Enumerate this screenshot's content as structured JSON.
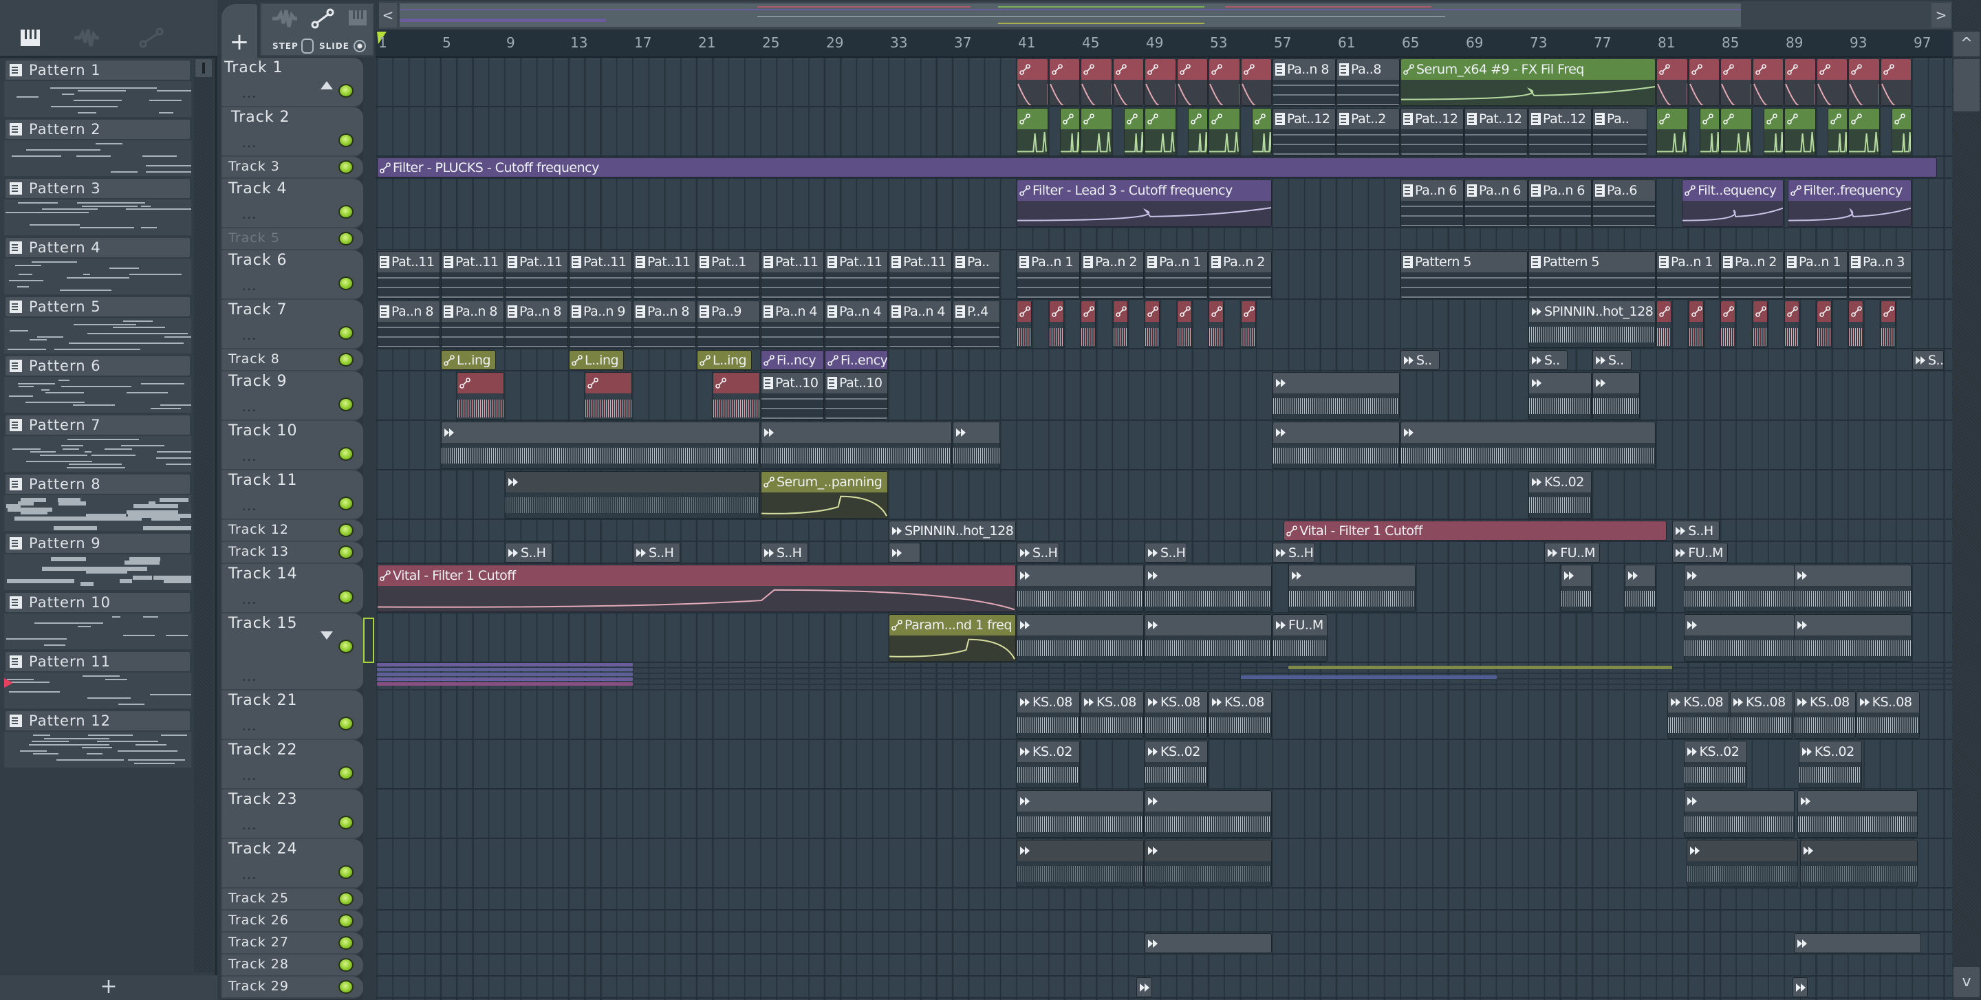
{
  "toolbar": {
    "add_track": "+",
    "step_label": "STEP",
    "slide_label": "SLIDE",
    "add_pattern": "+",
    "scroll_left": "<",
    "scroll_right": ">",
    "scroll_up": "^",
    "scroll_down": "v"
  },
  "patterns": [
    "Pattern 1",
    "Pattern 2",
    "Pattern 3",
    "Pattern 4",
    "Pattern 5",
    "Pattern 6",
    "Pattern 7",
    "Pattern 8",
    "Pattern 9",
    "Pattern 10",
    "Pattern 11",
    "Pattern 12"
  ],
  "playing_pattern": "Pattern 11",
  "ruler": [
    1,
    5,
    9,
    13,
    17,
    21,
    25,
    29,
    33,
    37,
    41,
    45,
    49,
    53,
    57,
    61,
    65,
    69,
    73,
    77,
    81,
    85,
    89,
    93,
    97
  ],
  "tracks": [
    {
      "name": "Track 1"
    },
    {
      "name": "Track 2"
    },
    {
      "name": "Track 3"
    },
    {
      "name": "Track 4"
    },
    {
      "name": "Track 5",
      "disabled": true
    },
    {
      "name": "Track 6"
    },
    {
      "name": "Track 7"
    },
    {
      "name": "Track 8"
    },
    {
      "name": "Track 9"
    },
    {
      "name": "Track 10"
    },
    {
      "name": "Track 11"
    },
    {
      "name": "Track 12"
    },
    {
      "name": "Track 13"
    },
    {
      "name": "Track 14"
    },
    {
      "name": "Track 15"
    },
    {
      "name": "Track 21"
    },
    {
      "name": "Track 22"
    },
    {
      "name": "Track 23"
    },
    {
      "name": "Track 24"
    },
    {
      "name": "Track 25"
    },
    {
      "name": "Track 26"
    },
    {
      "name": "Track 27"
    },
    {
      "name": "Track 28"
    },
    {
      "name": "Track 29"
    }
  ],
  "track_more_label": "...",
  "collapsed_group_lines": [
    {
      "start": 1,
      "len": 16,
      "color": "#6b5c9c"
    },
    {
      "start": 1,
      "len": 16,
      "color": "#5e5f96"
    },
    {
      "start": 1,
      "len": 16,
      "color": "#5e5f96"
    },
    {
      "start": 1,
      "len": 16,
      "color": "#6b5c9c"
    },
    {
      "start": 1,
      "len": 16,
      "color": "#8a4f82"
    },
    {
      "start": 58,
      "len": 24,
      "color": "#7f8a45"
    },
    {
      "start": 55,
      "len": 16,
      "color": "#4f5f96"
    }
  ],
  "clip_colors": {
    "p": {
      "head": "#4b545d",
      "body": "#2c3741"
    },
    "a": {
      "head": "#4d565f",
      "body": "#2e3b45"
    },
    "am": {
      "head": "#41494f",
      "body": "#2e3a44"
    },
    "ar": {
      "head": "#9a4b58",
      "body": "#3b3f48"
    },
    "arw": {
      "head": "#8c4650",
      "body": "#33404a"
    },
    "ag": {
      "head": "#5d8b46",
      "body": "#34453a"
    },
    "au": {
      "head": "#5e5087",
      "body": "#3b3a4f"
    },
    "ao": {
      "head": "#7a8341",
      "body": "#373d33"
    },
    "ap": {
      "head": "#8b4a5e",
      "body": "#3e3c46"
    }
  },
  "clips": [
    [
      1,
      41,
      2,
      "",
      "ar"
    ],
    [
      1,
      43,
      2,
      "",
      "ar"
    ],
    [
      1,
      45,
      2,
      "",
      "ar"
    ],
    [
      1,
      47,
      2,
      "",
      "ar"
    ],
    [
      1,
      49,
      2,
      "",
      "ar"
    ],
    [
      1,
      51,
      2,
      "",
      "ar"
    ],
    [
      1,
      53,
      2,
      "",
      "ar"
    ],
    [
      1,
      55,
      2,
      "",
      "ar"
    ],
    [
      1,
      57,
      4,
      "Pa..n 8",
      "p"
    ],
    [
      1,
      61,
      4,
      "Pa..8",
      "p"
    ],
    [
      1,
      65,
      16,
      "Serum_x64 #9 - FX Fil Freq",
      "ag"
    ],
    [
      1,
      81,
      2,
      "",
      "ar"
    ],
    [
      1,
      83,
      2,
      "",
      "ar"
    ],
    [
      1,
      85,
      2,
      "",
      "ar"
    ],
    [
      1,
      87,
      2,
      "",
      "ar"
    ],
    [
      1,
      89,
      2,
      "",
      "ar"
    ],
    [
      1,
      91,
      2,
      "",
      "ar"
    ],
    [
      1,
      93,
      2,
      "",
      "ar"
    ],
    [
      1,
      95,
      2,
      "",
      "ar"
    ],
    [
      2,
      41,
      2,
      "",
      "ag"
    ],
    [
      2,
      43.7,
      1.3,
      "",
      "ag"
    ],
    [
      2,
      45,
      2,
      "",
      "ag"
    ],
    [
      2,
      47.7,
      1.3,
      "",
      "ag"
    ],
    [
      2,
      49,
      2,
      "",
      "ag"
    ],
    [
      2,
      51.7,
      1.3,
      "",
      "ag"
    ],
    [
      2,
      53,
      2,
      "",
      "ag"
    ],
    [
      2,
      55.7,
      1.3,
      "",
      "ag"
    ],
    [
      2,
      57,
      4,
      "Pat..12",
      "p"
    ],
    [
      2,
      61,
      4,
      "Pat..2",
      "p"
    ],
    [
      2,
      65,
      4,
      "Pat..12",
      "p"
    ],
    [
      2,
      69,
      4,
      "Pat..12",
      "p"
    ],
    [
      2,
      73,
      4,
      "Pat..12",
      "p"
    ],
    [
      2,
      77,
      3.5,
      "Pa..",
      "p"
    ],
    [
      2,
      81,
      2,
      "",
      "ag"
    ],
    [
      2,
      83.7,
      1.3,
      "",
      "ag"
    ],
    [
      2,
      85,
      2,
      "",
      "ag"
    ],
    [
      2,
      87.7,
      1.3,
      "",
      "ag"
    ],
    [
      2,
      89,
      2,
      "",
      "ag"
    ],
    [
      2,
      91.7,
      1.3,
      "",
      "ag"
    ],
    [
      2,
      93,
      2,
      "",
      "ag"
    ],
    [
      2,
      95.7,
      1.3,
      "",
      "ag"
    ],
    [
      3,
      1,
      97.6,
      "Filter - PLUCKS - Cutoff frequency",
      "au"
    ],
    [
      4,
      41,
      16,
      "Filter - Lead 3 - Cutoff frequency",
      "au"
    ],
    [
      4,
      65,
      4,
      "Pa..n 6",
      "p"
    ],
    [
      4,
      69,
      4,
      "Pa..n 6",
      "p"
    ],
    [
      4,
      73,
      4,
      "Pa..n 6",
      "p"
    ],
    [
      4,
      77,
      4,
      "Pa..6",
      "p"
    ],
    [
      4,
      82.6,
      6.4,
      "Filt..equency",
      "au"
    ],
    [
      4,
      89.2,
      7.8,
      "Filter..frequency",
      "au"
    ],
    [
      6,
      1,
      4,
      "Pat..11",
      "p"
    ],
    [
      6,
      5,
      4,
      "Pat..11",
      "p"
    ],
    [
      6,
      9,
      4,
      "Pat..11",
      "p"
    ],
    [
      6,
      13,
      4,
      "Pat..11",
      "p"
    ],
    [
      6,
      17,
      4,
      "Pat..11",
      "p"
    ],
    [
      6,
      21,
      4,
      "Pat..1",
      "p"
    ],
    [
      6,
      25,
      4,
      "Pat..11",
      "p"
    ],
    [
      6,
      29,
      4,
      "Pat..11",
      "p"
    ],
    [
      6,
      33,
      4,
      "Pat..11",
      "p"
    ],
    [
      6,
      37,
      3,
      "Pa..",
      "p"
    ],
    [
      6,
      41,
      4,
      "Pa..n 1",
      "p"
    ],
    [
      6,
      45,
      4,
      "Pa..n 2",
      "p"
    ],
    [
      6,
      49,
      4,
      "Pa..n 1",
      "p"
    ],
    [
      6,
      53,
      4,
      "Pa..n 2",
      "p"
    ],
    [
      6,
      65,
      8,
      "Pattern 5",
      "p"
    ],
    [
      6,
      73,
      8,
      "Pattern 5",
      "p"
    ],
    [
      6,
      81,
      4,
      "Pa..n 1",
      "p"
    ],
    [
      6,
      85,
      4,
      "Pa..n 2",
      "p"
    ],
    [
      6,
      89,
      4,
      "Pa..n 1",
      "p"
    ],
    [
      6,
      93,
      4,
      "Pa..n 3",
      "p"
    ],
    [
      7,
      1,
      4,
      "Pa..n 8",
      "p"
    ],
    [
      7,
      5,
      4,
      "Pa..n 8",
      "p"
    ],
    [
      7,
      9,
      4,
      "Pa..n 8",
      "p"
    ],
    [
      7,
      13,
      4,
      "Pa..n 9",
      "p"
    ],
    [
      7,
      17,
      4,
      "Pa..n 8",
      "p"
    ],
    [
      7,
      21,
      4,
      "Pa..9",
      "p"
    ],
    [
      7,
      25,
      4,
      "Pa..n 4",
      "p"
    ],
    [
      7,
      29,
      4,
      "Pa..n 4",
      "p"
    ],
    [
      7,
      33,
      4,
      "Pa..n 4",
      "p"
    ],
    [
      7,
      37,
      3,
      "P..4",
      "p"
    ],
    [
      7,
      41,
      1,
      "",
      "arw"
    ],
    [
      7,
      43,
      1,
      "",
      "arw"
    ],
    [
      7,
      45,
      1,
      "",
      "arw"
    ],
    [
      7,
      47,
      1,
      "",
      "arw"
    ],
    [
      7,
      49,
      1,
      "",
      "arw"
    ],
    [
      7,
      51,
      1,
      "",
      "arw"
    ],
    [
      7,
      53,
      1,
      "",
      "arw"
    ],
    [
      7,
      55,
      1,
      "",
      "arw"
    ],
    [
      7,
      73,
      8,
      "SPINNIN..hot_128",
      "a"
    ],
    [
      7,
      81,
      1,
      "",
      "arw"
    ],
    [
      7,
      83,
      1,
      "",
      "arw"
    ],
    [
      7,
      85,
      1,
      "",
      "arw"
    ],
    [
      7,
      87,
      1,
      "",
      "arw"
    ],
    [
      7,
      89,
      1,
      "",
      "arw"
    ],
    [
      7,
      91,
      1,
      "",
      "arw"
    ],
    [
      7,
      93,
      1,
      "",
      "arw"
    ],
    [
      7,
      95,
      1,
      "",
      "arw"
    ],
    [
      8,
      5,
      3.5,
      "L..ing",
      "ao"
    ],
    [
      8,
      13,
      3.5,
      "L..ing",
      "ao"
    ],
    [
      8,
      21,
      3.5,
      "L..ing",
      "ao"
    ],
    [
      8,
      25,
      4,
      "Fi..ncy",
      "au"
    ],
    [
      8,
      29,
      4,
      "Fi..ency",
      "au"
    ],
    [
      8,
      65,
      2.5,
      "S..",
      "a"
    ],
    [
      8,
      73,
      2.5,
      "S..",
      "a"
    ],
    [
      8,
      77,
      2.5,
      "S..",
      "a"
    ],
    [
      8,
      97,
      2,
      "S..H",
      "a"
    ],
    [
      9,
      6,
      3,
      "",
      "arw"
    ],
    [
      9,
      14,
      3,
      "",
      "arw"
    ],
    [
      9,
      22,
      3,
      "",
      "arw"
    ],
    [
      9,
      25,
      4,
      "Pat..10",
      "p"
    ],
    [
      9,
      29,
      4,
      "Pat..10",
      "p"
    ],
    [
      9,
      57,
      8,
      "",
      "a"
    ],
    [
      9,
      73,
      4,
      "",
      "a"
    ],
    [
      9,
      77,
      3,
      "",
      "a"
    ],
    [
      10,
      5,
      20,
      "",
      "a"
    ],
    [
      10,
      25,
      12,
      "",
      "a"
    ],
    [
      10,
      37,
      3,
      "",
      "a"
    ],
    [
      10,
      57,
      8,
      "",
      "a"
    ],
    [
      10,
      65,
      16,
      "",
      "a"
    ],
    [
      11,
      9,
      16,
      "",
      "am"
    ],
    [
      11,
      25,
      8,
      "Serum_..panning",
      "ao"
    ],
    [
      11,
      73,
      4,
      "KS..02",
      "a"
    ],
    [
      12,
      33,
      8,
      "SPINNIN..hot_128",
      "a"
    ],
    [
      12,
      57.7,
      24,
      "Vital - Filter 1 Cutoff",
      "ap"
    ],
    [
      12,
      82,
      3,
      "S..H",
      "a"
    ],
    [
      13,
      9,
      3,
      "S..H",
      "a"
    ],
    [
      13,
      17,
      3,
      "S..H",
      "a"
    ],
    [
      13,
      25,
      3,
      "S..H",
      "a"
    ],
    [
      13,
      33,
      2,
      "",
      "a"
    ],
    [
      13,
      41,
      2.7,
      "S..H",
      "a"
    ],
    [
      13,
      49,
      2.7,
      "S..H",
      "a"
    ],
    [
      13,
      57,
      2.7,
      "S..H",
      "a"
    ],
    [
      13,
      74,
      3.5,
      "FU..M",
      "a"
    ],
    [
      13,
      82,
      3.5,
      "FU..M",
      "a"
    ],
    [
      14,
      1,
      40,
      "Vital - Filter 1 Cutoff",
      "ap"
    ],
    [
      14,
      41,
      8,
      "",
      "a"
    ],
    [
      14,
      49,
      8,
      "",
      "a"
    ],
    [
      14,
      58,
      8,
      "",
      "a"
    ],
    [
      14,
      75,
      2,
      "",
      "a"
    ],
    [
      14,
      79,
      2,
      "",
      "a"
    ],
    [
      14,
      82.7,
      7,
      "",
      "a"
    ],
    [
      14,
      89.6,
      7.4,
      "",
      "a"
    ],
    [
      15,
      33,
      8,
      "Param...nd 1 freq",
      "ao"
    ],
    [
      15,
      41,
      8,
      "",
      "a"
    ],
    [
      15,
      49,
      8,
      "",
      "a"
    ],
    [
      15,
      57,
      3.5,
      "FU..M",
      "a"
    ],
    [
      15,
      82.7,
      7,
      "",
      "a"
    ],
    [
      15,
      89.6,
      7.4,
      "",
      "a"
    ],
    [
      21,
      41,
      4,
      "KS..08",
      "a"
    ],
    [
      21,
      45,
      4,
      "KS..08",
      "a"
    ],
    [
      21,
      49,
      4,
      "KS..08",
      "a"
    ],
    [
      21,
      53,
      4,
      "KS..08",
      "a"
    ],
    [
      21,
      81.7,
      3.9,
      "KS..08",
      "a"
    ],
    [
      21,
      85.6,
      4,
      "KS..08",
      "a"
    ],
    [
      21,
      89.6,
      3.9,
      "KS..08",
      "a"
    ],
    [
      21,
      93.5,
      4,
      "KS..08",
      "a"
    ],
    [
      22,
      41,
      4,
      "KS..02",
      "a"
    ],
    [
      22,
      49,
      4,
      "KS..02",
      "a"
    ],
    [
      22,
      82.7,
      4,
      "KS..02",
      "a"
    ],
    [
      22,
      89.9,
      4,
      "KS..02",
      "a"
    ],
    [
      23,
      41,
      8,
      "",
      "a"
    ],
    [
      23,
      49,
      8,
      "",
      "a"
    ],
    [
      23,
      82.7,
      7,
      "",
      "a"
    ],
    [
      23,
      89.8,
      7.6,
      "",
      "a"
    ],
    [
      24,
      41,
      8,
      "",
      "am"
    ],
    [
      24,
      49,
      8,
      "",
      "am"
    ],
    [
      24,
      82.9,
      7,
      "",
      "am"
    ],
    [
      24,
      90,
      7.4,
      "",
      "am"
    ],
    [
      27,
      49,
      8,
      "",
      "a"
    ],
    [
      27,
      89.6,
      8,
      "",
      "a"
    ],
    [
      29,
      48.5,
      1,
      "",
      "a"
    ],
    [
      29,
      89.5,
      1,
      "",
      "a"
    ]
  ]
}
